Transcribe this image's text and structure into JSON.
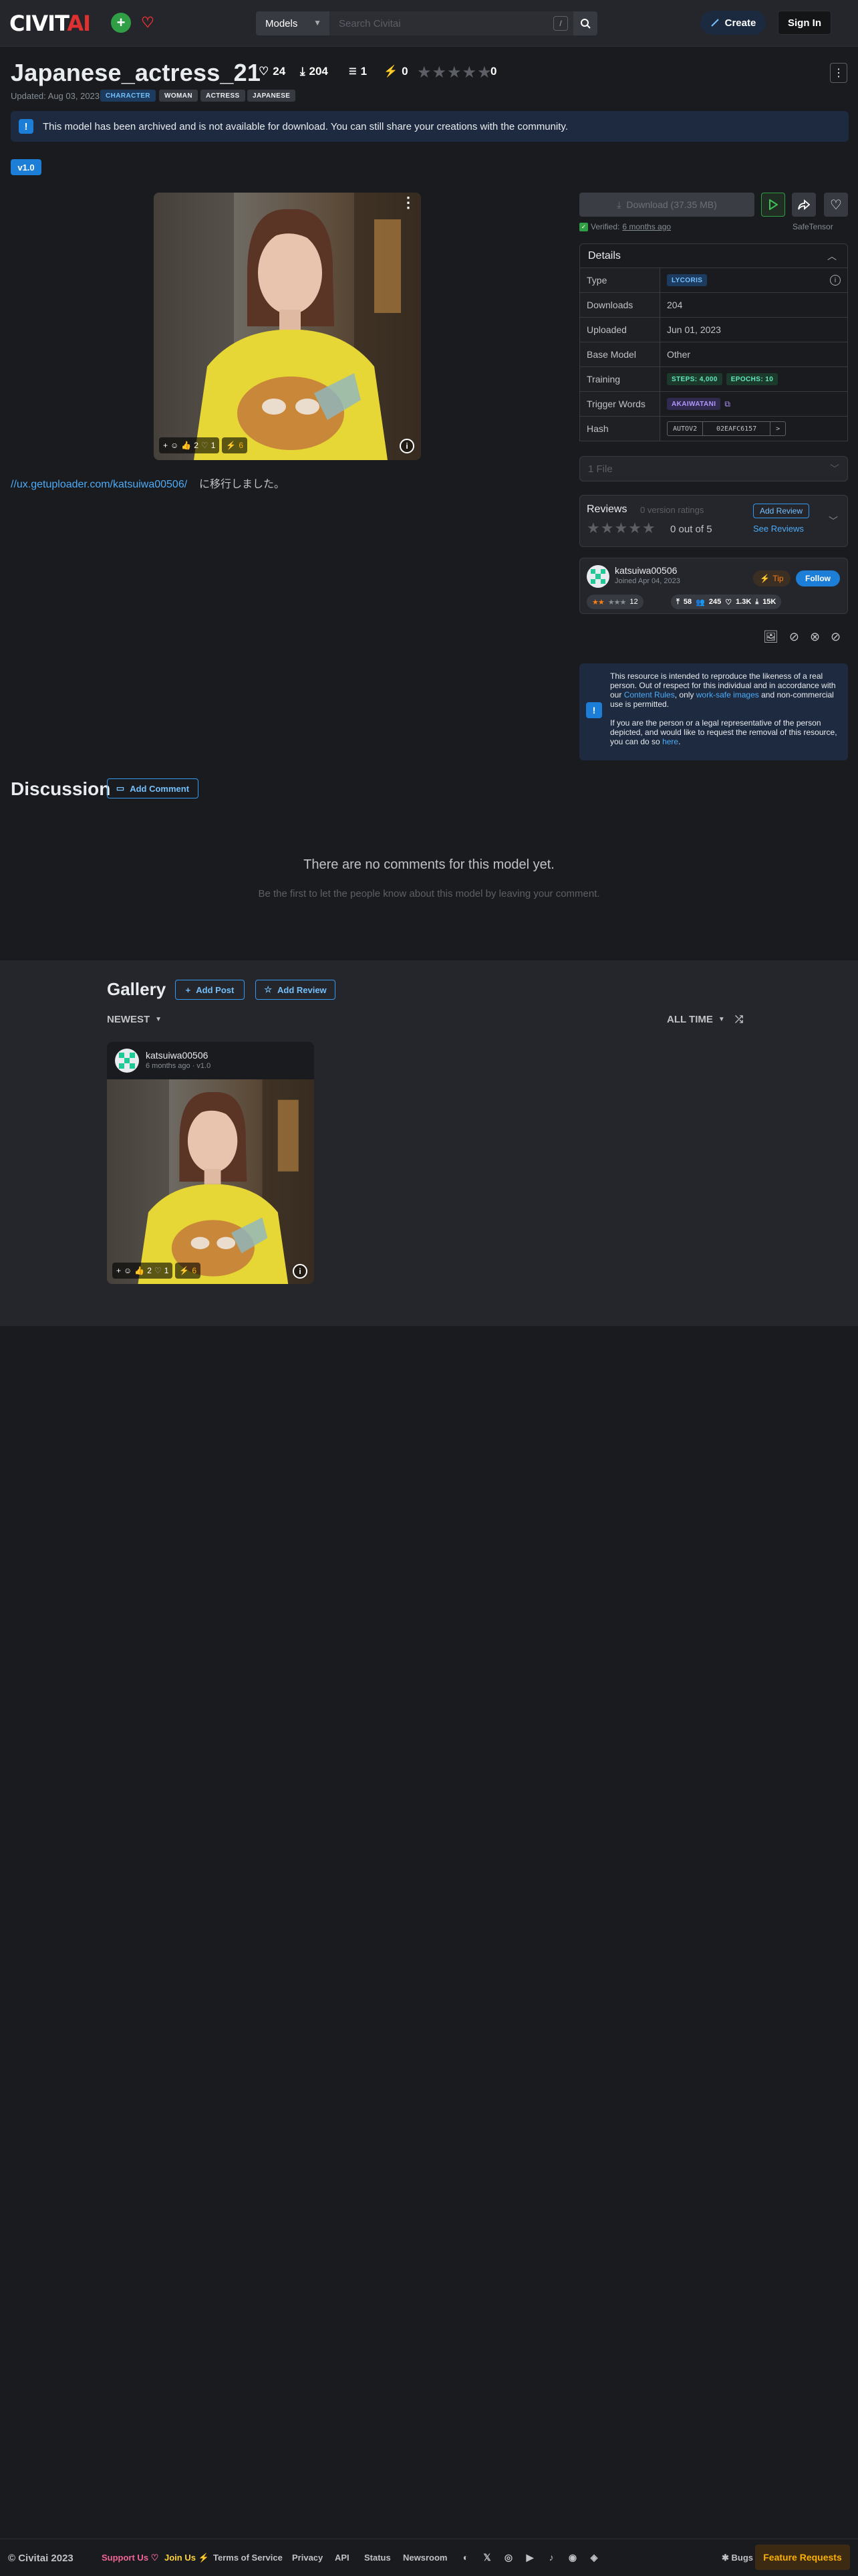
{
  "header": {
    "logo_left": "CIVIT",
    "logo_right": "AI",
    "search_type": "Models",
    "search_placeholder": "Search Civitai",
    "search_shortcut": "/",
    "create_label": "Create",
    "signin_label": "Sign In"
  },
  "model": {
    "title": "Japanese_actress_21",
    "likes": "24",
    "downloads": "204",
    "comments": "1",
    "buzz": "0",
    "rating_count": "0",
    "updated": "Updated: Aug 03, 2023",
    "tags": [
      "CHARACTER",
      "WOMAN",
      "ACTRESS",
      "JAPANESE"
    ],
    "archived_notice": "This model has been archived and is not available for download. You can still share your creations with the community.",
    "version": "v1.0",
    "description_link": "//ux.getuploader.com/katsuiwa00506/",
    "description_text": "に移行しました。"
  },
  "main_image": {
    "reactions": {
      "plus": "+",
      "likes": "2",
      "hearts": "1",
      "buzz": "6"
    }
  },
  "sidebar": {
    "download_label": "Download (37.35 MB)",
    "verified_label": "Verified:",
    "verified_when": "6 months ago",
    "safetensor": "SafeTensor",
    "details_title": "Details",
    "details": {
      "type_label": "Type",
      "type_value": "LYCORIS",
      "downloads_label": "Downloads",
      "downloads_value": "204",
      "uploaded_label": "Uploaded",
      "uploaded_value": "Jun 01, 2023",
      "base_label": "Base Model",
      "base_value": "Other",
      "training_label": "Training",
      "steps": "STEPS: 4,000",
      "epochs": "EPOCHS: 10",
      "trigger_label": "Trigger Words",
      "trigger": "AKAIWATANI",
      "hash_label": "Hash",
      "hash_type": "AUTOV2",
      "hash_value": "02EAFC6157"
    },
    "files_label": "1 File",
    "reviews_label": "Reviews",
    "reviews_count": "0 version ratings",
    "reviews_score": "0 out of 5",
    "add_review": "Add Review",
    "see_reviews": "See Reviews",
    "creator": {
      "name": "katsuiwa00506",
      "joined": "Joined Apr 04, 2023",
      "tip": "Tip",
      "follow": "Follow",
      "rating_count": "12",
      "uploads": "58",
      "followers": "245",
      "likes": "1.3K",
      "downloads": "15K"
    },
    "likeness_p1_a": "This resource is intended to reproduce the likeness of a real person. Out of respect for this individual and in accordance with our ",
    "likeness_rules": "Content Rules",
    "likeness_p1_b": ", only ",
    "likeness_sfw": "work-safe images",
    "likeness_p1_c": " and non-commercial use is permitted.",
    "likeness_p2": "If you are the person or a legal representative of the person depicted, and would like to request the removal of this resource, you can do so ",
    "likeness_here": "here",
    "likeness_end": "."
  },
  "discussion": {
    "title": "Discussion",
    "add_comment": "Add Comment",
    "empty_title": "There are no comments for this model yet.",
    "empty_sub": "Be the first to let the people know about this model by leaving your comment."
  },
  "gallery": {
    "title": "Gallery",
    "add_post": "Add Post",
    "add_review": "Add Review",
    "sort": "NEWEST",
    "period": "ALL TIME",
    "card": {
      "user": "katsuiwa00506",
      "meta": "6 months ago · v1.0",
      "likes": "2",
      "hearts": "1",
      "buzz": "6"
    }
  },
  "footer": {
    "copyright": "© Civitai 2023",
    "support": "Support Us",
    "join": "Join Us",
    "terms": "Terms of Service",
    "privacy": "Privacy",
    "api": "API",
    "status": "Status",
    "newsroom": "Newsroom",
    "bugs": "Bugs",
    "feature": "Feature Requests"
  },
  "colors": {
    "accent": "#1c7ed6",
    "brand_red": "#e03131",
    "background": "#1a1b1e"
  }
}
